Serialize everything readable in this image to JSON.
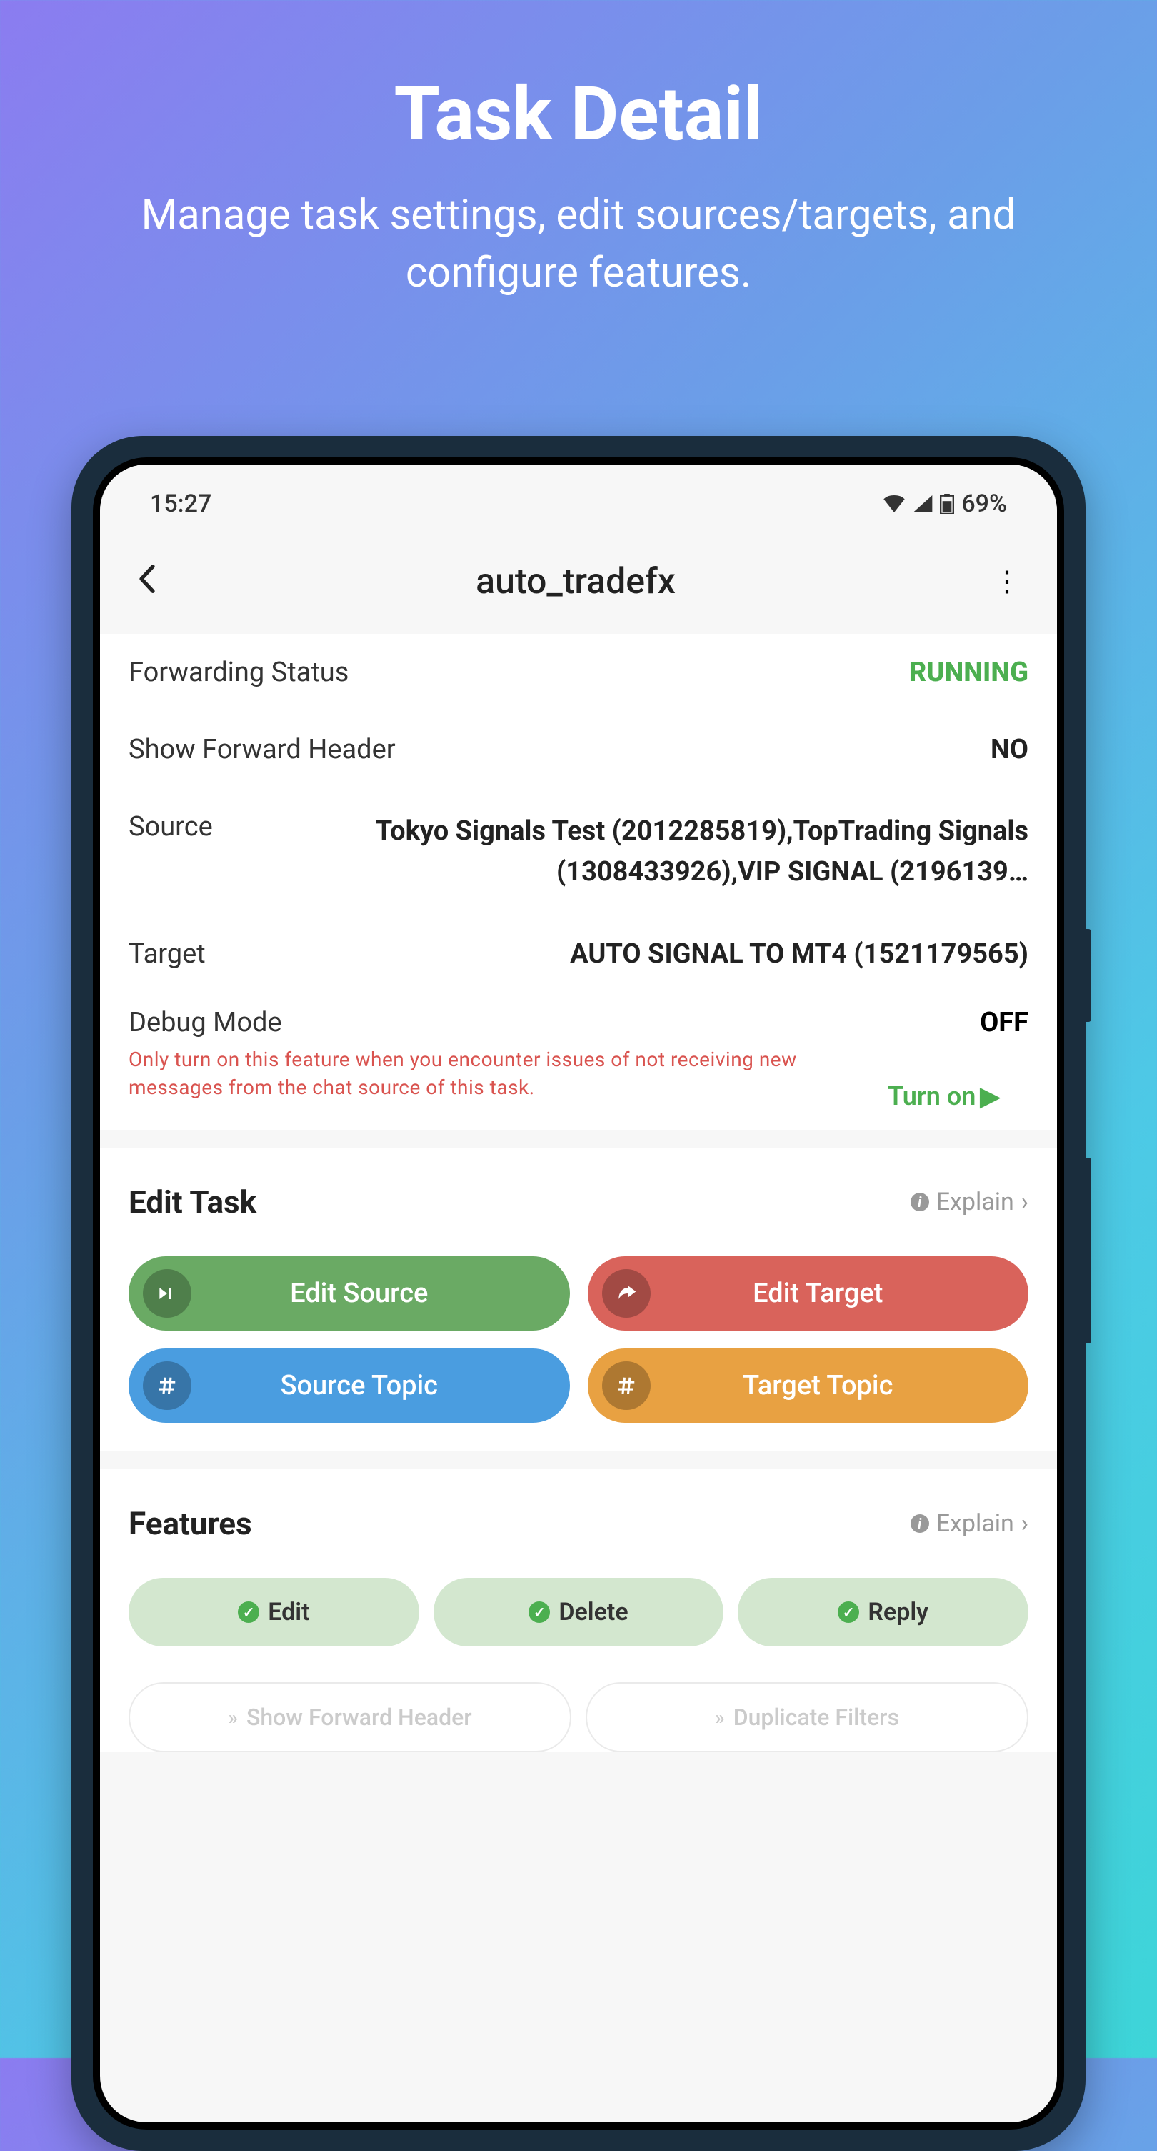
{
  "promo": {
    "title": "Task Detail",
    "subtitle": "Manage task settings, edit sources/targets, and configure features."
  },
  "status_bar": {
    "time": "15:27",
    "battery": "69%"
  },
  "header": {
    "title": "auto_tradefx"
  },
  "info": {
    "forwarding_status_label": "Forwarding Status",
    "forwarding_status_value": "RUNNING",
    "show_forward_header_label": "Show Forward Header",
    "show_forward_header_value": "NO",
    "source_label": "Source",
    "source_value": "Tokyo Signals Test (2012285819),TopTrading Signals (1308433926),VIP SIGNAL (2196139…",
    "target_label": "Target",
    "target_value": "AUTO SIGNAL TO MT4 (1521179565)",
    "debug_label": "Debug Mode",
    "debug_value": "OFF",
    "debug_hint": "Only turn on this feature when you encounter issues of not receiving new messages from the chat source of this task.",
    "turn_on_label": "Turn on"
  },
  "sections": {
    "edit_task_title": "Edit Task",
    "features_title": "Features",
    "explain_label": "Explain"
  },
  "edit_buttons": {
    "edit_source": "Edit Source",
    "edit_target": "Edit Target",
    "source_topic": "Source Topic",
    "target_topic": "Target Topic"
  },
  "feature_chips": {
    "edit": "Edit",
    "delete": "Delete",
    "reply": "Reply"
  },
  "bottom_chips": {
    "show_forward_header": "Show Forward Header",
    "duplicate_filters": "Duplicate Filters"
  }
}
